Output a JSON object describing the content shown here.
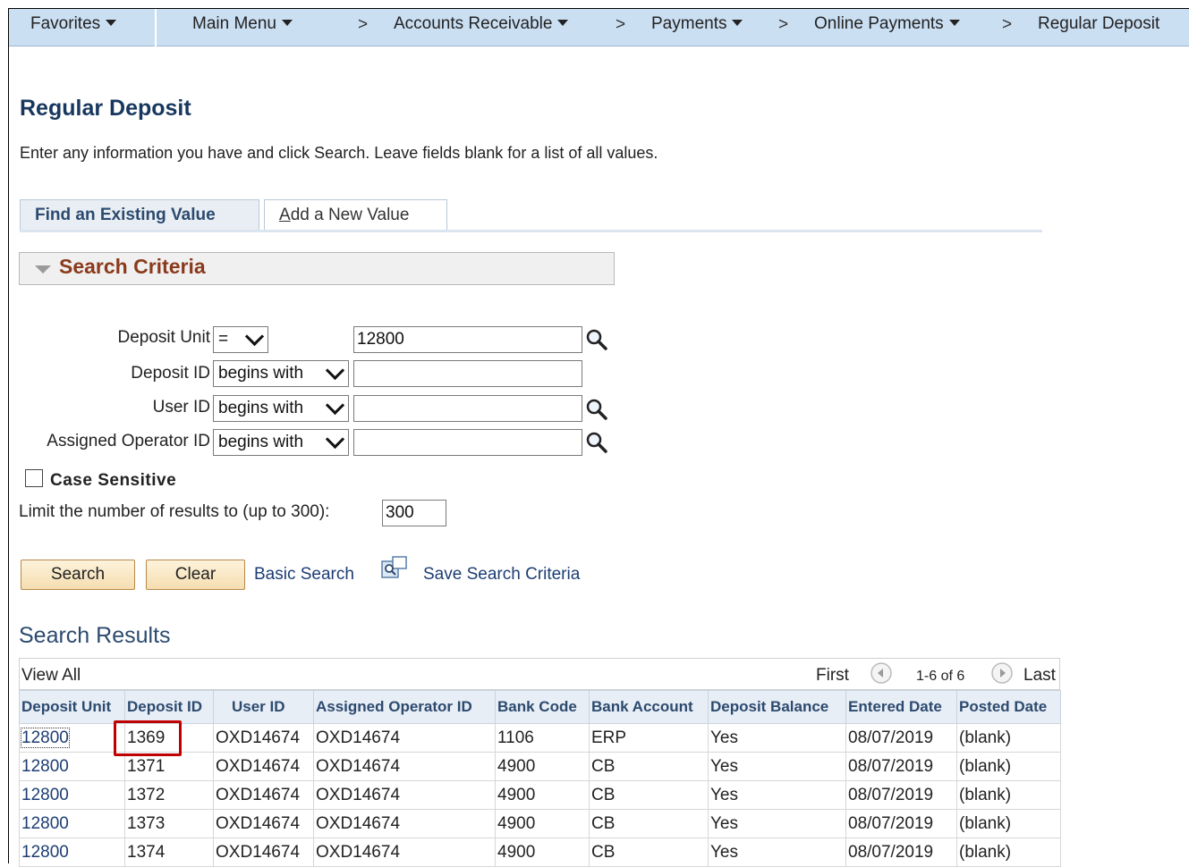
{
  "nav": {
    "favorites": "Favorites",
    "main_menu": "Main Menu",
    "breadcrumb_sep": ">",
    "accounts_receivable": "Accounts Receivable",
    "payments": "Payments",
    "online_payments": "Online Payments",
    "regular_deposit": "Regular Deposit"
  },
  "page": {
    "title": "Regular Deposit",
    "instructions": "Enter any information you have and click Search. Leave fields blank for a list of all values."
  },
  "tabs": {
    "find": "Find an Existing Value",
    "add_underlined": "A",
    "add_rest": "dd a New Value"
  },
  "search_criteria": {
    "header": "Search Criteria",
    "fields": [
      {
        "label": "Deposit Unit",
        "operator": "=",
        "value": ""
      },
      {
        "label": "Deposit ID",
        "operator": "begins with",
        "value": ""
      },
      {
        "label": "User ID",
        "operator": "begins with",
        "value": ""
      },
      {
        "label": "Assigned Operator ID",
        "operator": "begins with",
        "value": ""
      }
    ],
    "deposit_unit_value": "12800",
    "case_sensitive": "Case Sensitive",
    "limit_label": "Limit the number of results to (up to 300):",
    "limit_value": "300"
  },
  "buttons": {
    "search": "Search",
    "clear": "Clear",
    "basic_search": "Basic Search",
    "save_search": "Save Search Criteria"
  },
  "results": {
    "title": "Search Results",
    "view_all": "View All",
    "first": "First",
    "range": "1-6 of 6",
    "last": "Last",
    "columns": [
      "Deposit Unit",
      "Deposit ID",
      "User ID",
      "Assigned Operator ID",
      "Bank Code",
      "Bank Account",
      "Deposit Balance",
      "Entered Date",
      "Posted Date"
    ],
    "rows": [
      [
        "12800",
        "1369",
        "OXD14674",
        "OXD14674",
        "1106",
        "ERP",
        "Yes",
        "08/07/2019",
        "(blank)"
      ],
      [
        "12800",
        "1371",
        "OXD14674",
        "OXD14674",
        "4900",
        "CB",
        "Yes",
        "08/07/2019",
        "(blank)"
      ],
      [
        "12800",
        "1372",
        "OXD14674",
        "OXD14674",
        "4900",
        "CB",
        "Yes",
        "08/07/2019",
        "(blank)"
      ],
      [
        "12800",
        "1373",
        "OXD14674",
        "OXD14674",
        "4900",
        "CB",
        "Yes",
        "08/07/2019",
        "(blank)"
      ],
      [
        "12800",
        "1374",
        "OXD14674",
        "OXD14674",
        "4900",
        "CB",
        "Yes",
        "08/07/2019",
        "(blank)"
      ]
    ]
  },
  "colors": {
    "nav_bg": "#cbdff3",
    "title": "#17375e",
    "criteria_header": "#8b3a1c",
    "highlight": "#c00000"
  }
}
